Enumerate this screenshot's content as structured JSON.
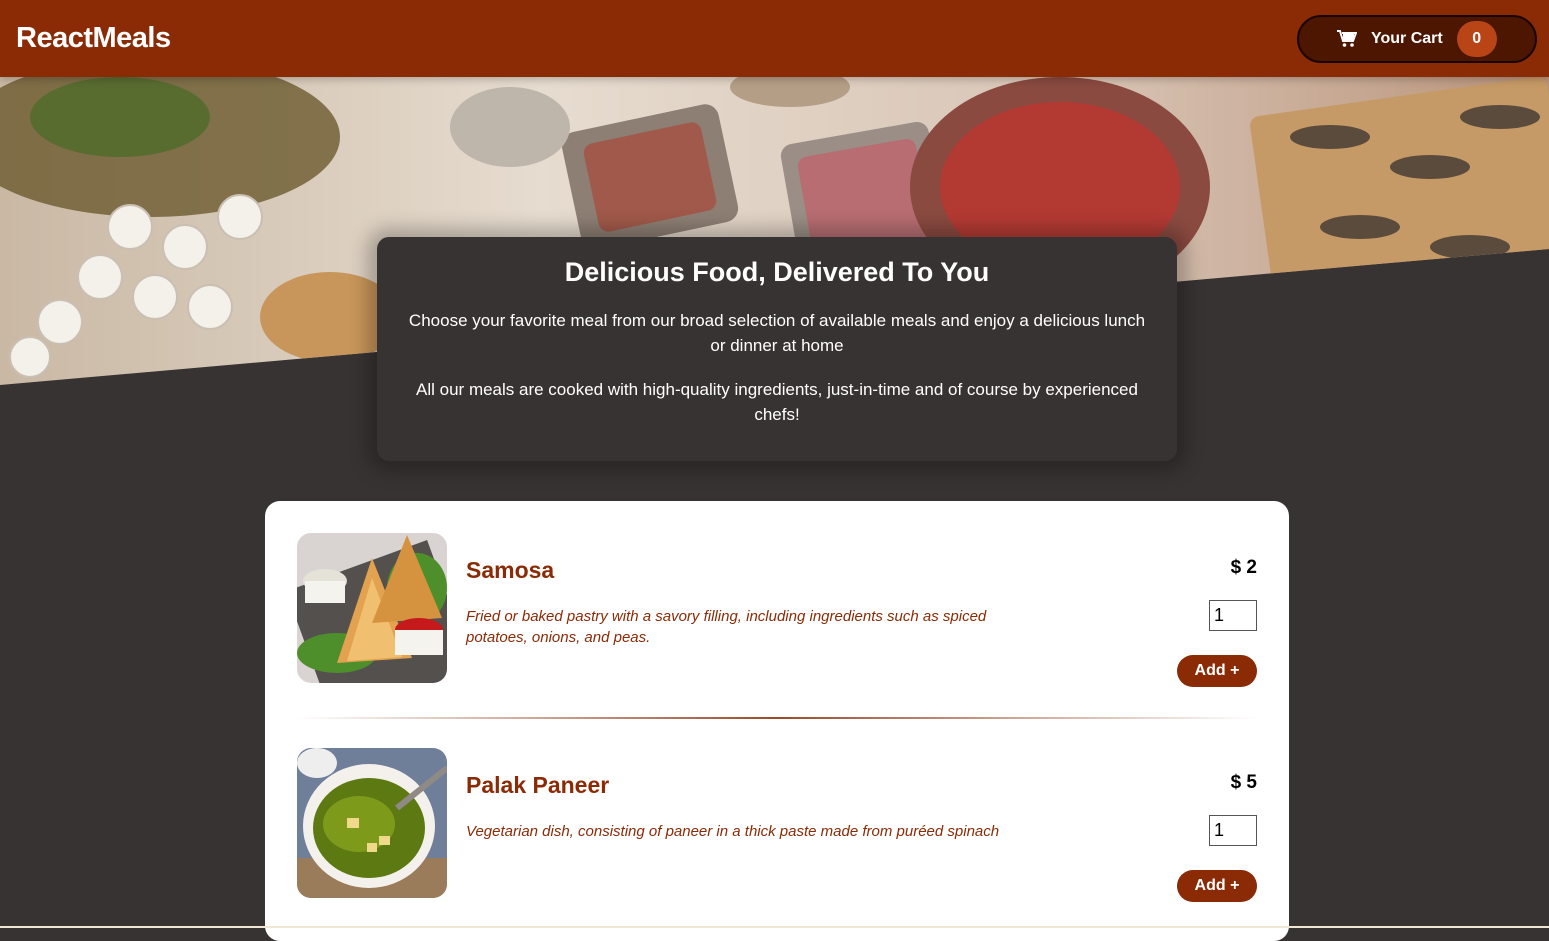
{
  "header": {
    "brand": "ReactMeals",
    "cart_label": "Your Cart",
    "cart_count": "0",
    "cart_icon": "shopping-cart-icon"
  },
  "hero": {
    "image": "banquet-table-food-photo"
  },
  "summary": {
    "title": "Delicious Food, Delivered To You",
    "paragraph1": "Choose your favorite meal from our broad selection of available meals and enjoy a delicious lunch or dinner at home",
    "paragraph2": "All our meals are cooked with high-quality ingredients, just-in-time and of course by experienced chefs!"
  },
  "meals": [
    {
      "name": "Samosa",
      "description": "Fried or baked pastry with a savory filling, including ingredients such as spiced potatoes, onions, and peas.",
      "price": "$ 2",
      "quantity": "1",
      "add_label": "Add +",
      "image": "samosa-photo"
    },
    {
      "name": "Palak Paneer",
      "description": "Vegetarian dish, consisting of paneer in a thick paste made from puréed spinach",
      "price": "$ 5",
      "quantity": "1",
      "add_label": "Add +",
      "image": "palak-paneer-photo"
    }
  ],
  "colors": {
    "brand": "#8a2b06",
    "background": "#383333",
    "cart_button": "#4d1601",
    "badge": "#b94517"
  }
}
